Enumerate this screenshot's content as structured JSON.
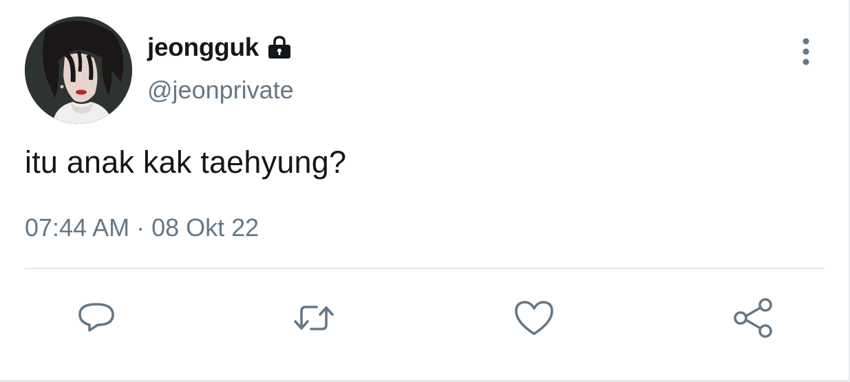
{
  "tweet": {
    "display_name": "jeongguk",
    "handle": "@jeonprivate",
    "text": "itu anak kak taehyung?",
    "time": "07:44 AM",
    "separator": " · ",
    "date": "08 Okt 22",
    "protected_icon": "lock-icon",
    "avatar": "avatar"
  },
  "actions": {
    "reply_icon": "reply-icon",
    "retweet_icon": "retweet-icon",
    "like_icon": "like-icon",
    "share_icon": "share-icon",
    "more_icon": "more-icon"
  },
  "colors": {
    "text_primary": "#14171a",
    "text_secondary": "#657786",
    "divider": "#e6e9ec",
    "icon": "#657786"
  }
}
